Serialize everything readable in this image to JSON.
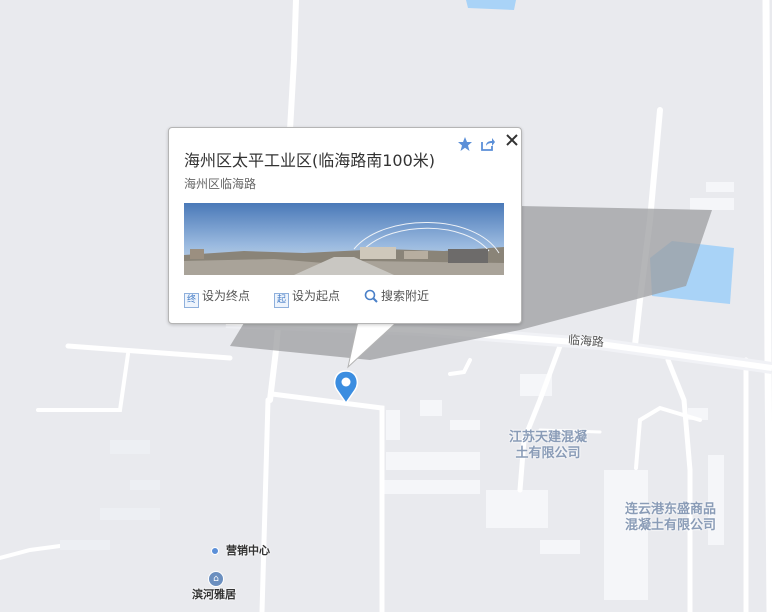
{
  "popup": {
    "title": "海州区太平工业区(临海路南100米)",
    "address": "海州区临海路",
    "actions": [
      {
        "icon": "终",
        "label": "设为终点"
      },
      {
        "icon": "起",
        "label": "设为起点"
      },
      {
        "icon": "search-icon",
        "label": "搜索附近"
      }
    ],
    "favorite_icon": "star-icon",
    "share_icon": "share-icon",
    "close_icon": "close-icon"
  },
  "map_labels": {
    "road": "临海路",
    "company1": [
      "江苏天建混凝",
      "土有限公司"
    ],
    "company2": [
      "连云港东盛商品",
      "混凝土有限公司"
    ],
    "poi1": "营销中心",
    "poi2": "滨河雅居"
  },
  "colors": {
    "map_bg": "#e9eaee",
    "road": "#ffffff",
    "water": "#a9d3f7",
    "building": "#f5f6f9",
    "marker": "#3b8de0"
  }
}
